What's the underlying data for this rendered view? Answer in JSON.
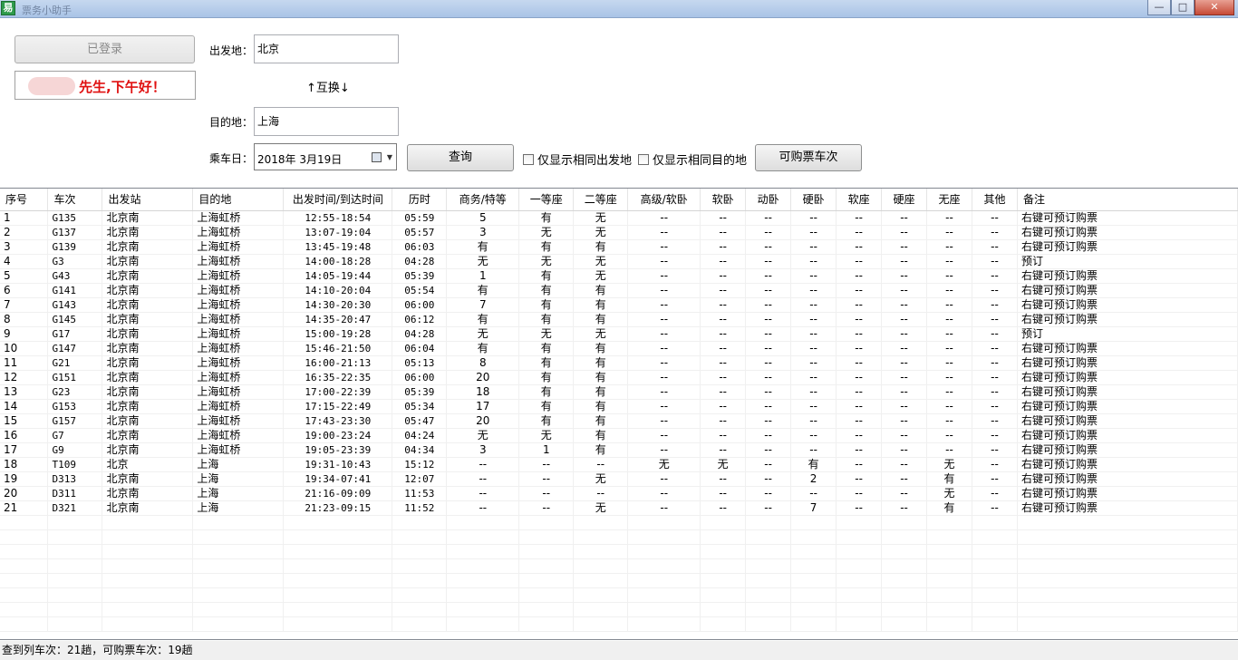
{
  "window": {
    "icon_glyph": "易",
    "title": "票务小助手",
    "min_glyph": "—",
    "max_glyph": "□",
    "close_glyph": "✕"
  },
  "login": {
    "button_label": "已登录"
  },
  "greeting": {
    "text": "先生,下午好！"
  },
  "form": {
    "from_label": "出发地：",
    "from_value": "北京",
    "swap_label": "↑互换↓",
    "to_label": "目的地：",
    "to_value": "上海",
    "date_label": "乘车日：",
    "date_value": "2018年  3月19日",
    "query_label": "查询",
    "only_same_from_label": "仅显示相同出发地",
    "only_same_to_label": "仅显示相同目的地",
    "buyable_label": "可购票车次"
  },
  "table": {
    "columns": [
      "序号",
      "车次",
      "出发站",
      "目的地",
      "出发时间/到达时间",
      "历时",
      "商务/特等",
      "一等座",
      "二等座",
      "高级/软卧",
      "软卧",
      "动卧",
      "硬卧",
      "软座",
      "硬座",
      "无座",
      "其他",
      "备注"
    ],
    "rows": [
      [
        "1",
        "G135",
        "北京南",
        "上海虹桥",
        "12:55-18:54",
        "05:59",
        "5",
        "有",
        "无",
        "--",
        "--",
        "--",
        "--",
        "--",
        "--",
        "--",
        "--",
        "右键可预订购票"
      ],
      [
        "2",
        "G137",
        "北京南",
        "上海虹桥",
        "13:07-19:04",
        "05:57",
        "3",
        "无",
        "无",
        "--",
        "--",
        "--",
        "--",
        "--",
        "--",
        "--",
        "--",
        "右键可预订购票"
      ],
      [
        "3",
        "G139",
        "北京南",
        "上海虹桥",
        "13:45-19:48",
        "06:03",
        "有",
        "有",
        "有",
        "--",
        "--",
        "--",
        "--",
        "--",
        "--",
        "--",
        "--",
        "右键可预订购票"
      ],
      [
        "4",
        "G3",
        "北京南",
        "上海虹桥",
        "14:00-18:28",
        "04:28",
        "无",
        "无",
        "无",
        "--",
        "--",
        "--",
        "--",
        "--",
        "--",
        "--",
        "--",
        "预订"
      ],
      [
        "5",
        "G43",
        "北京南",
        "上海虹桥",
        "14:05-19:44",
        "05:39",
        "1",
        "有",
        "无",
        "--",
        "--",
        "--",
        "--",
        "--",
        "--",
        "--",
        "--",
        "右键可预订购票"
      ],
      [
        "6",
        "G141",
        "北京南",
        "上海虹桥",
        "14:10-20:04",
        "05:54",
        "有",
        "有",
        "有",
        "--",
        "--",
        "--",
        "--",
        "--",
        "--",
        "--",
        "--",
        "右键可预订购票"
      ],
      [
        "7",
        "G143",
        "北京南",
        "上海虹桥",
        "14:30-20:30",
        "06:00",
        "7",
        "有",
        "有",
        "--",
        "--",
        "--",
        "--",
        "--",
        "--",
        "--",
        "--",
        "右键可预订购票"
      ],
      [
        "8",
        "G145",
        "北京南",
        "上海虹桥",
        "14:35-20:47",
        "06:12",
        "有",
        "有",
        "有",
        "--",
        "--",
        "--",
        "--",
        "--",
        "--",
        "--",
        "--",
        "右键可预订购票"
      ],
      [
        "9",
        "G17",
        "北京南",
        "上海虹桥",
        "15:00-19:28",
        "04:28",
        "无",
        "无",
        "无",
        "--",
        "--",
        "--",
        "--",
        "--",
        "--",
        "--",
        "--",
        "预订"
      ],
      [
        "10",
        "G147",
        "北京南",
        "上海虹桥",
        "15:46-21:50",
        "06:04",
        "有",
        "有",
        "有",
        "--",
        "--",
        "--",
        "--",
        "--",
        "--",
        "--",
        "--",
        "右键可预订购票"
      ],
      [
        "11",
        "G21",
        "北京南",
        "上海虹桥",
        "16:00-21:13",
        "05:13",
        "8",
        "有",
        "有",
        "--",
        "--",
        "--",
        "--",
        "--",
        "--",
        "--",
        "--",
        "右键可预订购票"
      ],
      [
        "12",
        "G151",
        "北京南",
        "上海虹桥",
        "16:35-22:35",
        "06:00",
        "20",
        "有",
        "有",
        "--",
        "--",
        "--",
        "--",
        "--",
        "--",
        "--",
        "--",
        "右键可预订购票"
      ],
      [
        "13",
        "G23",
        "北京南",
        "上海虹桥",
        "17:00-22:39",
        "05:39",
        "18",
        "有",
        "有",
        "--",
        "--",
        "--",
        "--",
        "--",
        "--",
        "--",
        "--",
        "右键可预订购票"
      ],
      [
        "14",
        "G153",
        "北京南",
        "上海虹桥",
        "17:15-22:49",
        "05:34",
        "17",
        "有",
        "有",
        "--",
        "--",
        "--",
        "--",
        "--",
        "--",
        "--",
        "--",
        "右键可预订购票"
      ],
      [
        "15",
        "G157",
        "北京南",
        "上海虹桥",
        "17:43-23:30",
        "05:47",
        "20",
        "有",
        "有",
        "--",
        "--",
        "--",
        "--",
        "--",
        "--",
        "--",
        "--",
        "右键可预订购票"
      ],
      [
        "16",
        "G7",
        "北京南",
        "上海虹桥",
        "19:00-23:24",
        "04:24",
        "无",
        "无",
        "有",
        "--",
        "--",
        "--",
        "--",
        "--",
        "--",
        "--",
        "--",
        "右键可预订购票"
      ],
      [
        "17",
        "G9",
        "北京南",
        "上海虹桥",
        "19:05-23:39",
        "04:34",
        "3",
        "1",
        "有",
        "--",
        "--",
        "--",
        "--",
        "--",
        "--",
        "--",
        "--",
        "右键可预订购票"
      ],
      [
        "18",
        "T109",
        "北京",
        "上海",
        "19:31-10:43",
        "15:12",
        "--",
        "--",
        "--",
        "无",
        "无",
        "--",
        "有",
        "--",
        "--",
        "无",
        "--",
        "右键可预订购票"
      ],
      [
        "19",
        "D313",
        "北京南",
        "上海",
        "19:34-07:41",
        "12:07",
        "--",
        "--",
        "无",
        "--",
        "--",
        "--",
        "2",
        "--",
        "--",
        "有",
        "--",
        "右键可预订购票"
      ],
      [
        "20",
        "D311",
        "北京南",
        "上海",
        "21:16-09:09",
        "11:53",
        "--",
        "--",
        "--",
        "--",
        "--",
        "--",
        "--",
        "--",
        "--",
        "无",
        "--",
        "右键可预订购票"
      ],
      [
        "21",
        "D321",
        "北京南",
        "上海",
        "21:23-09:15",
        "11:52",
        "--",
        "--",
        "无",
        "--",
        "--",
        "--",
        "7",
        "--",
        "--",
        "有",
        "--",
        "右键可预订购票"
      ]
    ]
  },
  "status": {
    "text": "查到列车次：21趟，可购票车次：19趟"
  }
}
